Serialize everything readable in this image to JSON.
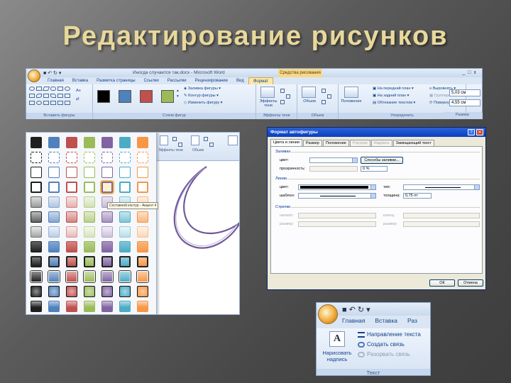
{
  "slide": {
    "title": "Редактирование рисунков"
  },
  "ribbon": {
    "doc_title": "Иногда случается так.docx - Microsoft Word",
    "context_tab": "Средства рисования",
    "tabs": [
      "Главная",
      "Вставка",
      "Разметка страницы",
      "Ссылки",
      "Рассылки",
      "Рецензирование",
      "Вид",
      "Формат"
    ],
    "active_tab": "Формат",
    "groups": {
      "insert_shapes": "Вставить фигуры",
      "shape_styles": "Стили фигур",
      "shadow_effects": "Эффекты тени",
      "volume": "Объем",
      "arrange": "Упорядочить",
      "size": "Размер"
    },
    "shape_fill": "Заливка фигуры",
    "shape_outline": "Контур фигуры",
    "change_shape": "Изменить фигуру",
    "effects_label": "Эффекты тени",
    "volume_btn": "Объем",
    "position_btn": "Положение",
    "bring_front": "На передний план",
    "send_back": "На задний план",
    "text_wrap": "Обтекание текстом",
    "align": "Выровнять",
    "group": "Группировать",
    "rotate": "Повернуть",
    "height": "5,03 см",
    "width": "4,55 см",
    "style_colors": [
      "#000000",
      "#4f81bd",
      "#c0504d",
      "#9bbb59"
    ]
  },
  "gallery": {
    "tooltip": "Составной контур - Акцент 4",
    "colors": [
      "#1f1f1f",
      "#4f81bd",
      "#c0504d",
      "#9bbb59",
      "#8064a2",
      "#4bacc6",
      "#f79646"
    ],
    "ribbon_labels": [
      "Эффекты тени",
      "Объем"
    ]
  },
  "dialog": {
    "title": "Формат автофигуры",
    "help": "?",
    "close": "✕",
    "tabs": [
      "Цвета и линии",
      "Размер",
      "Положение",
      "Рисунок",
      "Надпись",
      "Замещающий текст"
    ],
    "fill_section": "Заливка",
    "color_label": "цвет:",
    "transparency_label": "прозрачность:",
    "fill_effects_btn": "Способы заливки...",
    "transparency_value": "0 %",
    "line_section": "Линии",
    "line_color_label": "цвет:",
    "line_type_label": "тип:",
    "dash_label": "шаблон:",
    "weight_label": "толщина:",
    "weight_value": "0,75 пт",
    "arrows_section": "Стрелки",
    "begin_label": "начало:",
    "end_label": "конец:",
    "begin_size_label": "размер:",
    "end_size_label": "размер:",
    "ok": "ОК",
    "cancel": "Отмена"
  },
  "text_ribbon": {
    "tabs": [
      "Главная",
      "Вставка",
      "Раз"
    ],
    "draw_text_box": "Нарисовать надпись",
    "text_direction": "Направление текста",
    "create_link": "Создать связь",
    "break_link": "Разорвать связь",
    "group_label": "Текст"
  }
}
